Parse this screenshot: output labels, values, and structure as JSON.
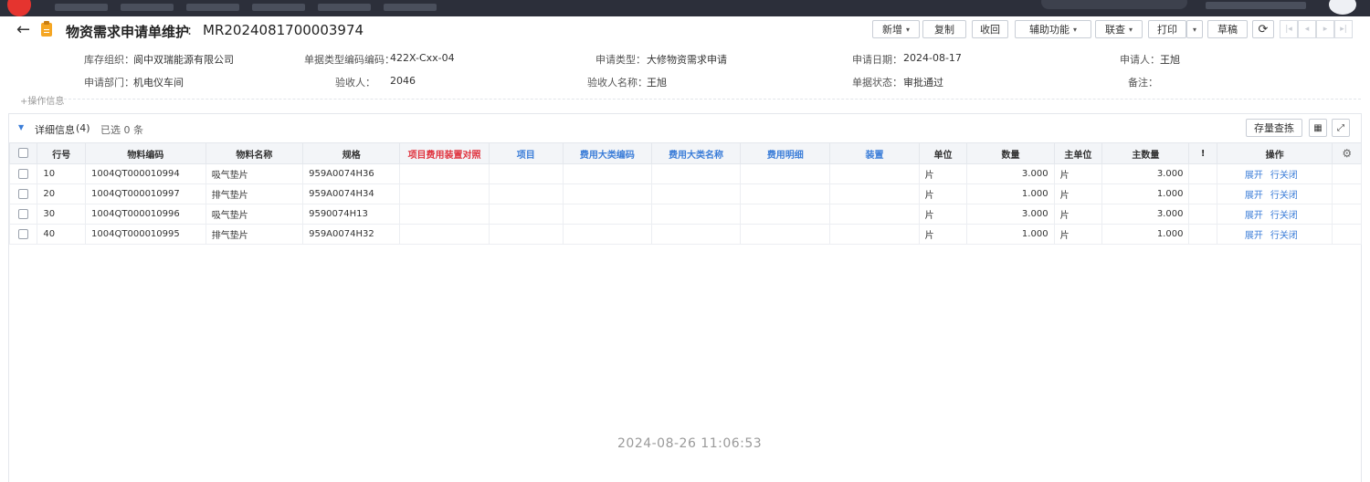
{
  "header": {
    "title": "物资需求申请单维护",
    "colon": ":",
    "doc_no": "MR2024081700003974"
  },
  "toolbar": {
    "add": "新增",
    "copy": "复制",
    "recall": "收回",
    "assist": "辅助功能",
    "linked": "联查",
    "print": "打印",
    "draft": "草稿"
  },
  "info": {
    "org_label": "库存组织：",
    "org_value": "阆中双瑞能源有限公司",
    "type_code_label": "单据类型编码编码：",
    "type_code_value": "422X-Cxx-04",
    "apply_type_label": "申请类型：",
    "apply_type_value": "大修物资需求申请",
    "apply_date_label": "申请日期：",
    "apply_date_value": "2024-08-17",
    "applicant_label": "申请人：",
    "applicant_value": "王旭",
    "dept_label": "申请部门：",
    "dept_value": "机电仪车间",
    "receiver_label": "验收人：",
    "receiver_value": "2046",
    "receiver_name_label": "验收人名称：",
    "receiver_name_value": "王旭",
    "status_label": "单据状态：",
    "status_value": "审批通过",
    "remark_label": "备注：",
    "remark_value": "",
    "op_info": "+操作信息"
  },
  "detail": {
    "title": "详细信息",
    "count": "(4)",
    "selected": "已选 0 条",
    "stock_query": "存量查拣",
    "columns": [
      "行号",
      "物料编码",
      "物料名称",
      "规格",
      "项目费用装置对照",
      "项目",
      "费用大类编码",
      "费用大类名称",
      "费用明细",
      "装置",
      "单位",
      "数量",
      "主单位",
      "主数量",
      "!",
      "操作"
    ],
    "rows": [
      {
        "line": "10",
        "code": "1004QT000010994",
        "name": "吸气垫片",
        "spec": "959A0074H36",
        "unit": "片",
        "qty": "3.000",
        "main_unit": "片",
        "main_qty": "3.000",
        "op1": "展开",
        "op2": "行关闭"
      },
      {
        "line": "20",
        "code": "1004QT000010997",
        "name": "排气垫片",
        "spec": "959A0074H34",
        "unit": "片",
        "qty": "1.000",
        "main_unit": "片",
        "main_qty": "1.000",
        "op1": "展开",
        "op2": "行关闭"
      },
      {
        "line": "30",
        "code": "1004QT000010996",
        "name": "吸气垫片",
        "spec": "9590074H13",
        "unit": "片",
        "qty": "3.000",
        "main_unit": "片",
        "main_qty": "3.000",
        "op1": "展开",
        "op2": "行关闭"
      },
      {
        "line": "40",
        "code": "1004QT000010995",
        "name": "排气垫片",
        "spec": "959A0074H32",
        "unit": "片",
        "qty": "1.000",
        "main_unit": "片",
        "main_qty": "1.000",
        "op1": "展开",
        "op2": "行关闭"
      }
    ]
  },
  "watermark": "2024-08-26 11:06:53",
  "icons": {
    "back": "←",
    "refresh": "⟳",
    "grid": "▦",
    "fullscreen": "⤢",
    "gear": "⚙",
    "expand_triangle": "▼",
    "caret": "▾",
    "pager_first": "|◂",
    "pager_prev": "◂",
    "pager_next": "▸",
    "pager_last": "▸|"
  },
  "colors": {
    "link": "#3b7dd8",
    "required_header": "#e0343f",
    "topbar": "#2c2f3a",
    "doc_icon": "#f5a623"
  }
}
